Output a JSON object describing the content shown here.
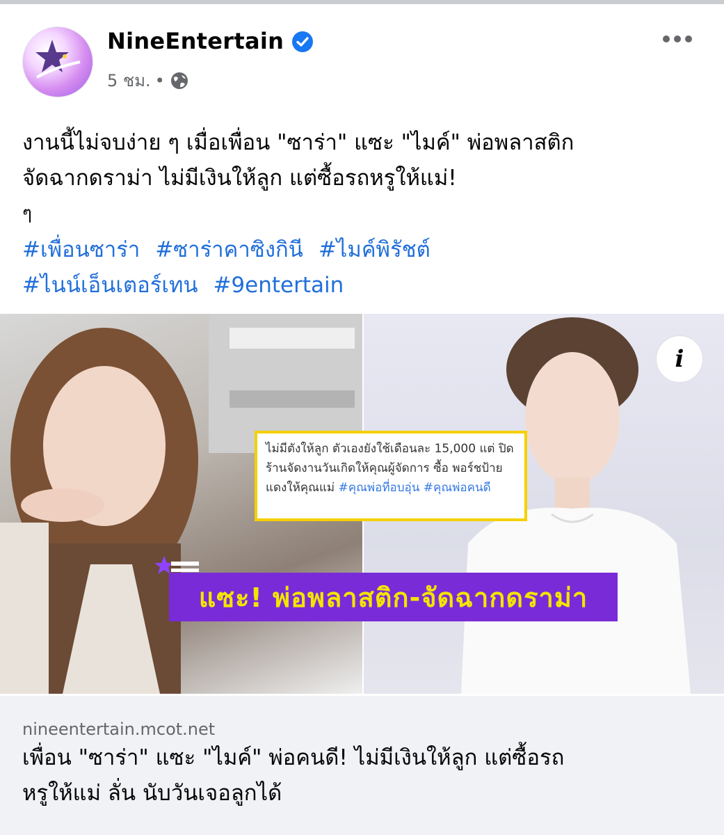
{
  "post": {
    "page_name": "NineEntertain",
    "time": "5 ชม.",
    "separator": "•",
    "text_lines": [
      "งานนี้ไม่จบง่าย ๆ เมื่อเพื่อน \"ซาร่า\" แซะ \"ไมค์\" พ่อพลาสติก",
      "จัดฉากดราม่า ไม่มีเงินให้ลูก แต่ซื้อรถหรูให้แม่!"
    ],
    "small_mark": "ๆ",
    "hashtags_line1": [
      "#เพื่อนซาร่า",
      "#ซาร่าคาซิงกินี",
      "#ไมค์พิรัชต์"
    ],
    "hashtags_line2": [
      "#ไนน์เอ็นเตอร์เทน",
      "#9entertain"
    ]
  },
  "media": {
    "quote_text": "ไม่มีตังให้ลูก ตัวเองยังใช้เดือนละ 15,000 แต่ ปิดร้านจัดงานวันเกิดให้คุณผู้จัดการ ซื้อ พอร์ชป้ายแดงให้คุณแม่",
    "quote_tag1": "#คุณพ่อที่อบอุ่น",
    "quote_tag2": "#คุณพ่อคนดี",
    "banner_text": "แซะ! พ่อพลาสติก-จัดฉากดราม่า",
    "info_icon": "i"
  },
  "link": {
    "domain": "nineentertain.mcot.net",
    "title_lines": [
      "เพื่อน \"ซาร่า\" แซะ \"ไมค์\" พ่อคนดี! ไม่มีเงินให้ลูก แต่ซื้อรถ",
      "หรูให้แม่ ลั่น นับวันเจอลูกได้"
    ]
  }
}
